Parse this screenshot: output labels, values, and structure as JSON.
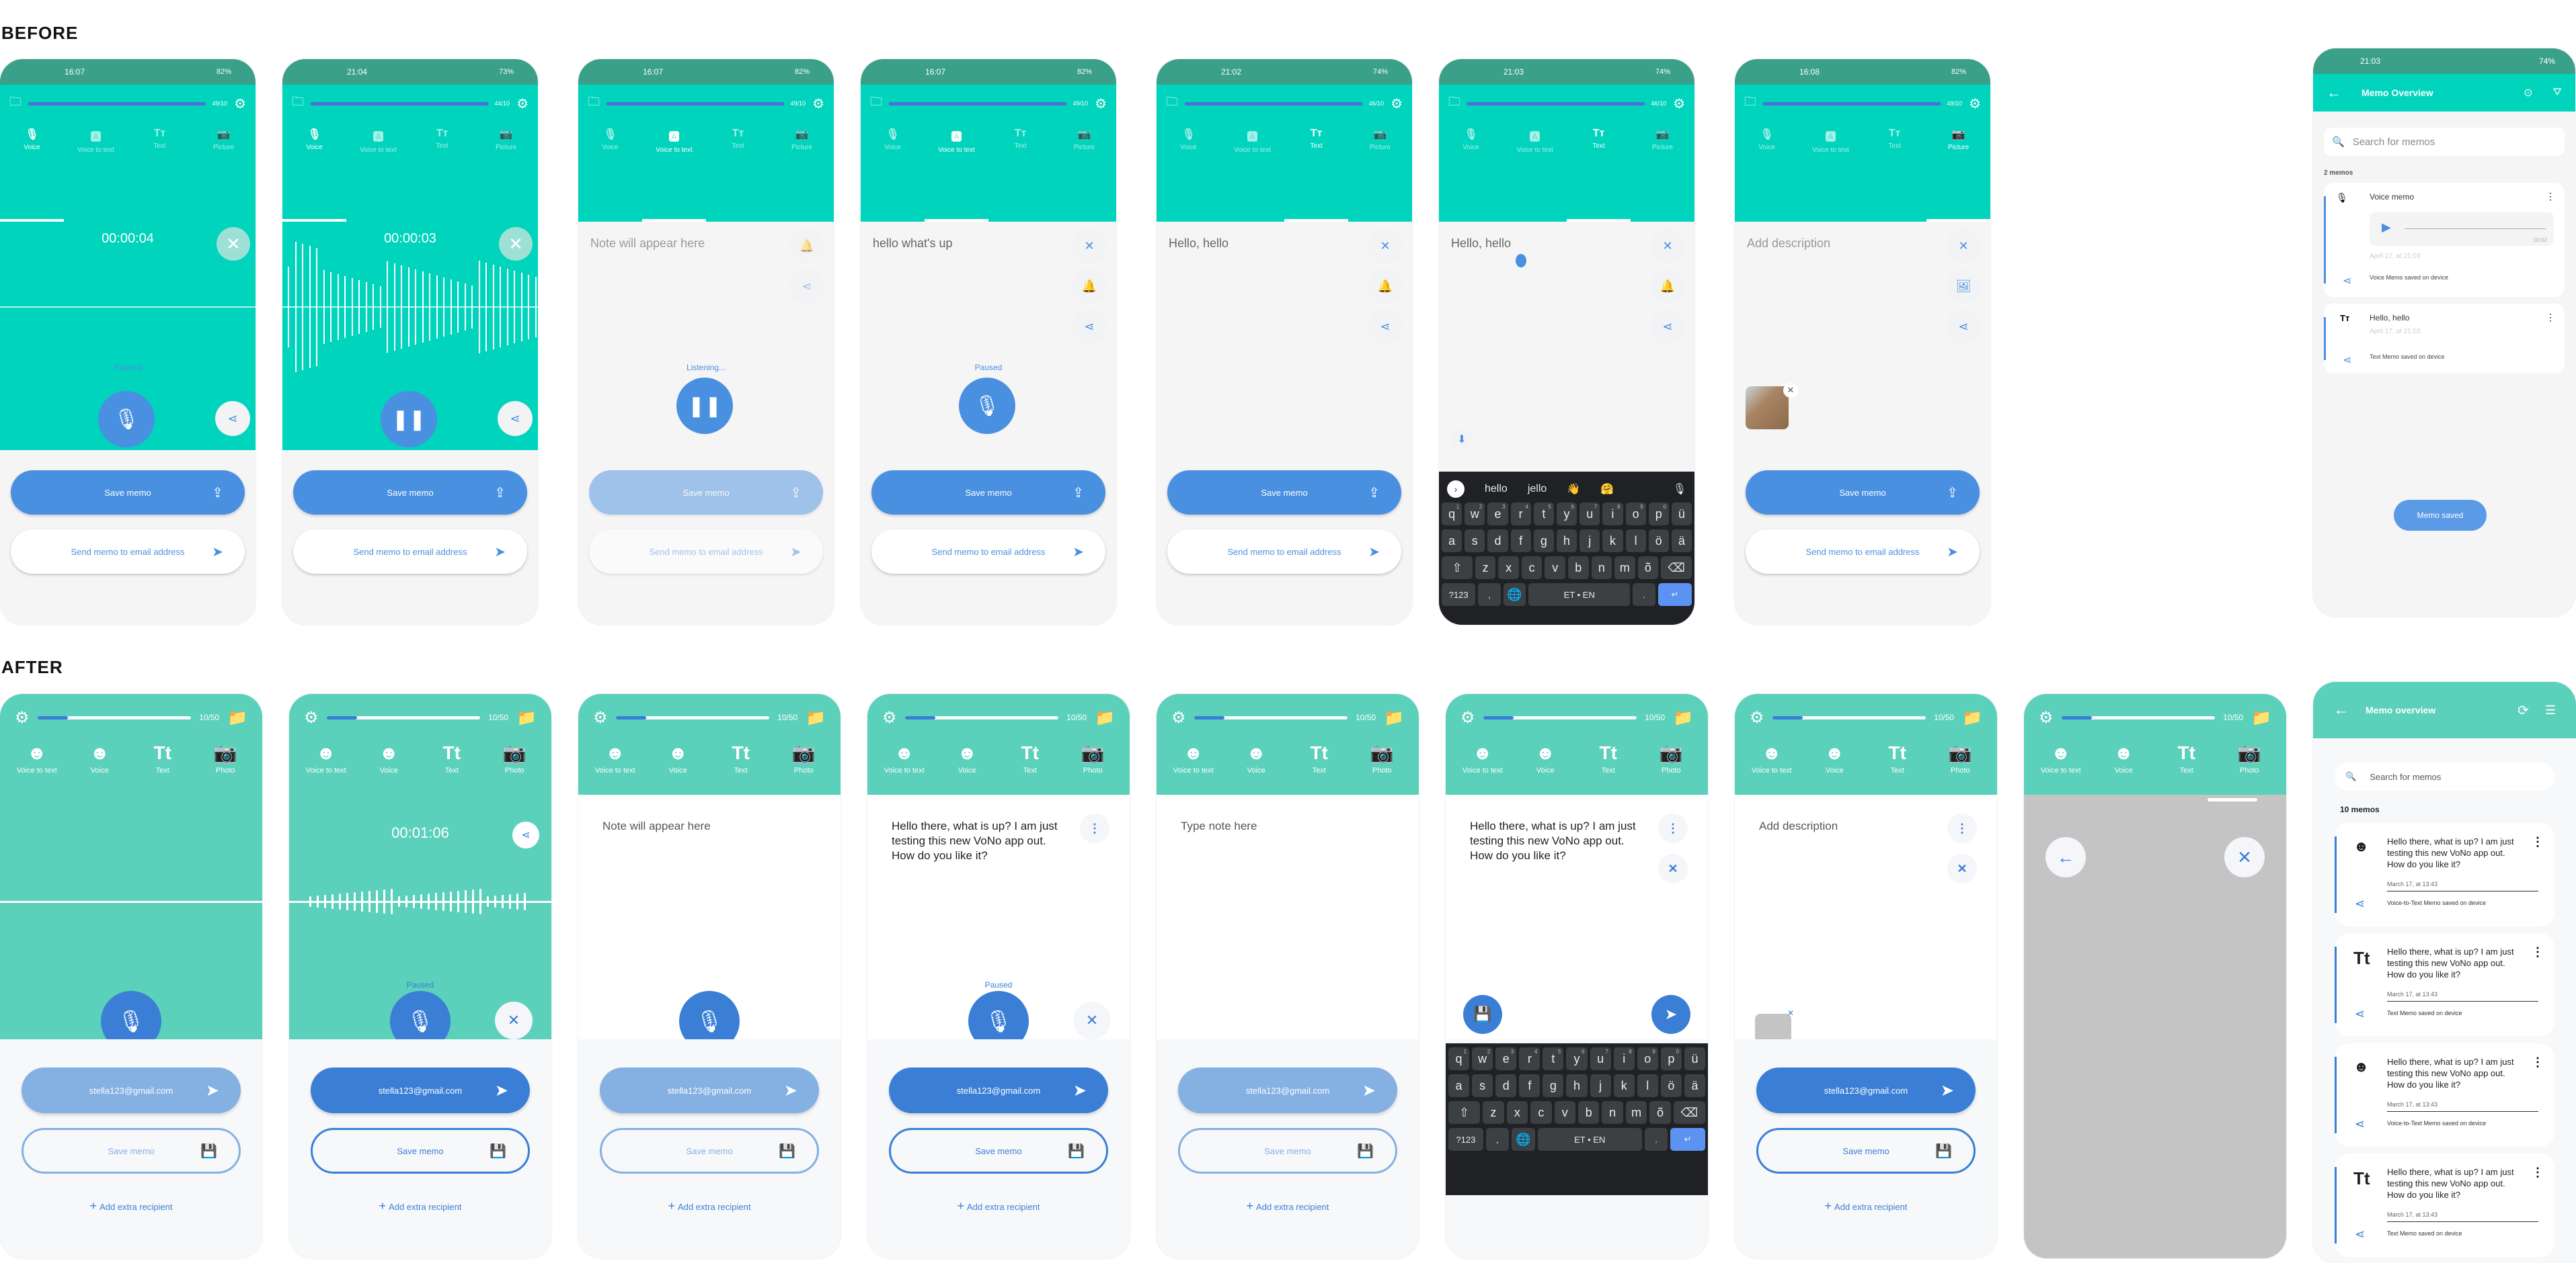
{
  "sections": {
    "before": "BEFORE",
    "after": "AFTER"
  },
  "colors": {
    "teal_before": "#00d4bd",
    "status_before": "#3aa08a",
    "teal_after": "#5bd0ba",
    "blue": "#3a7fd5",
    "blue_before": "#4a90e0"
  },
  "before": {
    "tabs": [
      "Voice",
      "Voice to text",
      "Text",
      "Picture"
    ],
    "save_label": "Save memo",
    "send_label": "Send memo to email address",
    "screens": [
      {
        "time": "16:07",
        "battery": "82%",
        "count": "49/10",
        "active_tab": 0,
        "timer": "00:00:04",
        "status": "Paused"
      },
      {
        "time": "21:04",
        "battery": "73%",
        "count": "44/10",
        "active_tab": 0,
        "timer": "00:00:03"
      },
      {
        "time": "16:07",
        "battery": "82%",
        "count": "49/10",
        "active_tab": 1,
        "note": "Note will appear here",
        "status": "Listening..."
      },
      {
        "time": "16:07",
        "battery": "82%",
        "count": "49/10",
        "active_tab": 1,
        "note": "hello what's up",
        "status": "Paused"
      },
      {
        "time": "21:02",
        "battery": "74%",
        "count": "46/10",
        "active_tab": 2,
        "note": "Hello, hello"
      },
      {
        "time": "21:03",
        "battery": "74%",
        "count": "46/10",
        "active_tab": 2,
        "note": "Hello, hello"
      },
      {
        "time": "16:08",
        "battery": "82%",
        "count": "49/10",
        "active_tab": 3,
        "note": "Add description"
      }
    ],
    "keyboard": {
      "suggestions": [
        "hello",
        "jello",
        "👋",
        "🤗"
      ],
      "rows": [
        [
          "q",
          "w",
          "e",
          "r",
          "t",
          "y",
          "u",
          "i",
          "o",
          "p",
          "ü"
        ],
        [
          "a",
          "s",
          "d",
          "f",
          "g",
          "h",
          "j",
          "k",
          "l",
          "ö",
          "ä"
        ],
        [
          "⇧",
          "z",
          "x",
          "c",
          "v",
          "b",
          "n",
          "m",
          "õ",
          "⌫"
        ]
      ],
      "numbers": [
        "1",
        "2",
        "3",
        "4",
        "5",
        "6",
        "7",
        "8",
        "9",
        "0"
      ],
      "symbols_key": "?123",
      "space_label": "ET • EN",
      "period": ".",
      "enter": "↵",
      "comma": ","
    },
    "overview": {
      "time": "21:03",
      "battery": "74%",
      "title": "Memo Overview",
      "search_placeholder": "Search for memos",
      "count_label": "2 memos",
      "memos": [
        {
          "title": "Voice memo",
          "duration": "00:02",
          "date": "April 17, at 21:03",
          "status": "Voice Memo saved on device"
        },
        {
          "title": "Hello, hello",
          "date": "April 17, at 21:03",
          "status": "Text Memo saved on device"
        }
      ],
      "toast": "Memo saved"
    }
  },
  "after": {
    "tabs": [
      "Voice to text",
      "Voice",
      "Text",
      "Photo"
    ],
    "count": "10/50",
    "progress": 0.2,
    "email": "stella123@gmail.com",
    "save_label": "Save memo",
    "add_recipient": "Add extra recipient",
    "screens": [
      {
        "active_tab": 1
      },
      {
        "active_tab": 1,
        "timer": "00:01:06",
        "status": "Paused"
      },
      {
        "active_tab": 0,
        "note": "Note will appear here"
      },
      {
        "active_tab": 0,
        "note": "Hello there, what is up? I am just testing this new VoNo app out. How do you like it?",
        "status": "Paused"
      },
      {
        "active_tab": 2,
        "note": "Type note here"
      },
      {
        "active_tab": 2,
        "note": "Hello there, what is up? I am just testing this new VoNo app out. How do you like it?"
      },
      {
        "active_tab": 3,
        "note": "Add description"
      },
      {
        "active_tab": 3
      }
    ],
    "overview": {
      "title": "Memo overview",
      "search_placeholder": "Search for memos",
      "count_label": "10 memos",
      "memos": [
        {
          "type": "voice-to-text",
          "text": "Hello there, what is up? I am just testing this new VoNo app out. How do you like it?",
          "date": "March 17, at 13:43",
          "status": "Voice-to-Text Memo saved on device"
        },
        {
          "type": "text",
          "text": "Hello there, what is up? I am just testing this new VoNo app out. How do you like it?",
          "date": "March 17, at 13:43",
          "status": "Text Memo saved on device"
        },
        {
          "type": "voice-to-text",
          "text": "Hello there, what is up? I am just testing this new VoNo app out. How do you like it?",
          "date": "March 17, at 13:43",
          "status": "Voice-to-Text Memo saved on device"
        },
        {
          "type": "text",
          "text": "Hello there, what is up? I am just testing this new VoNo app out. How do you like it?",
          "date": "March 17, at 13:43",
          "status": "Text Memo saved on device"
        }
      ]
    }
  }
}
